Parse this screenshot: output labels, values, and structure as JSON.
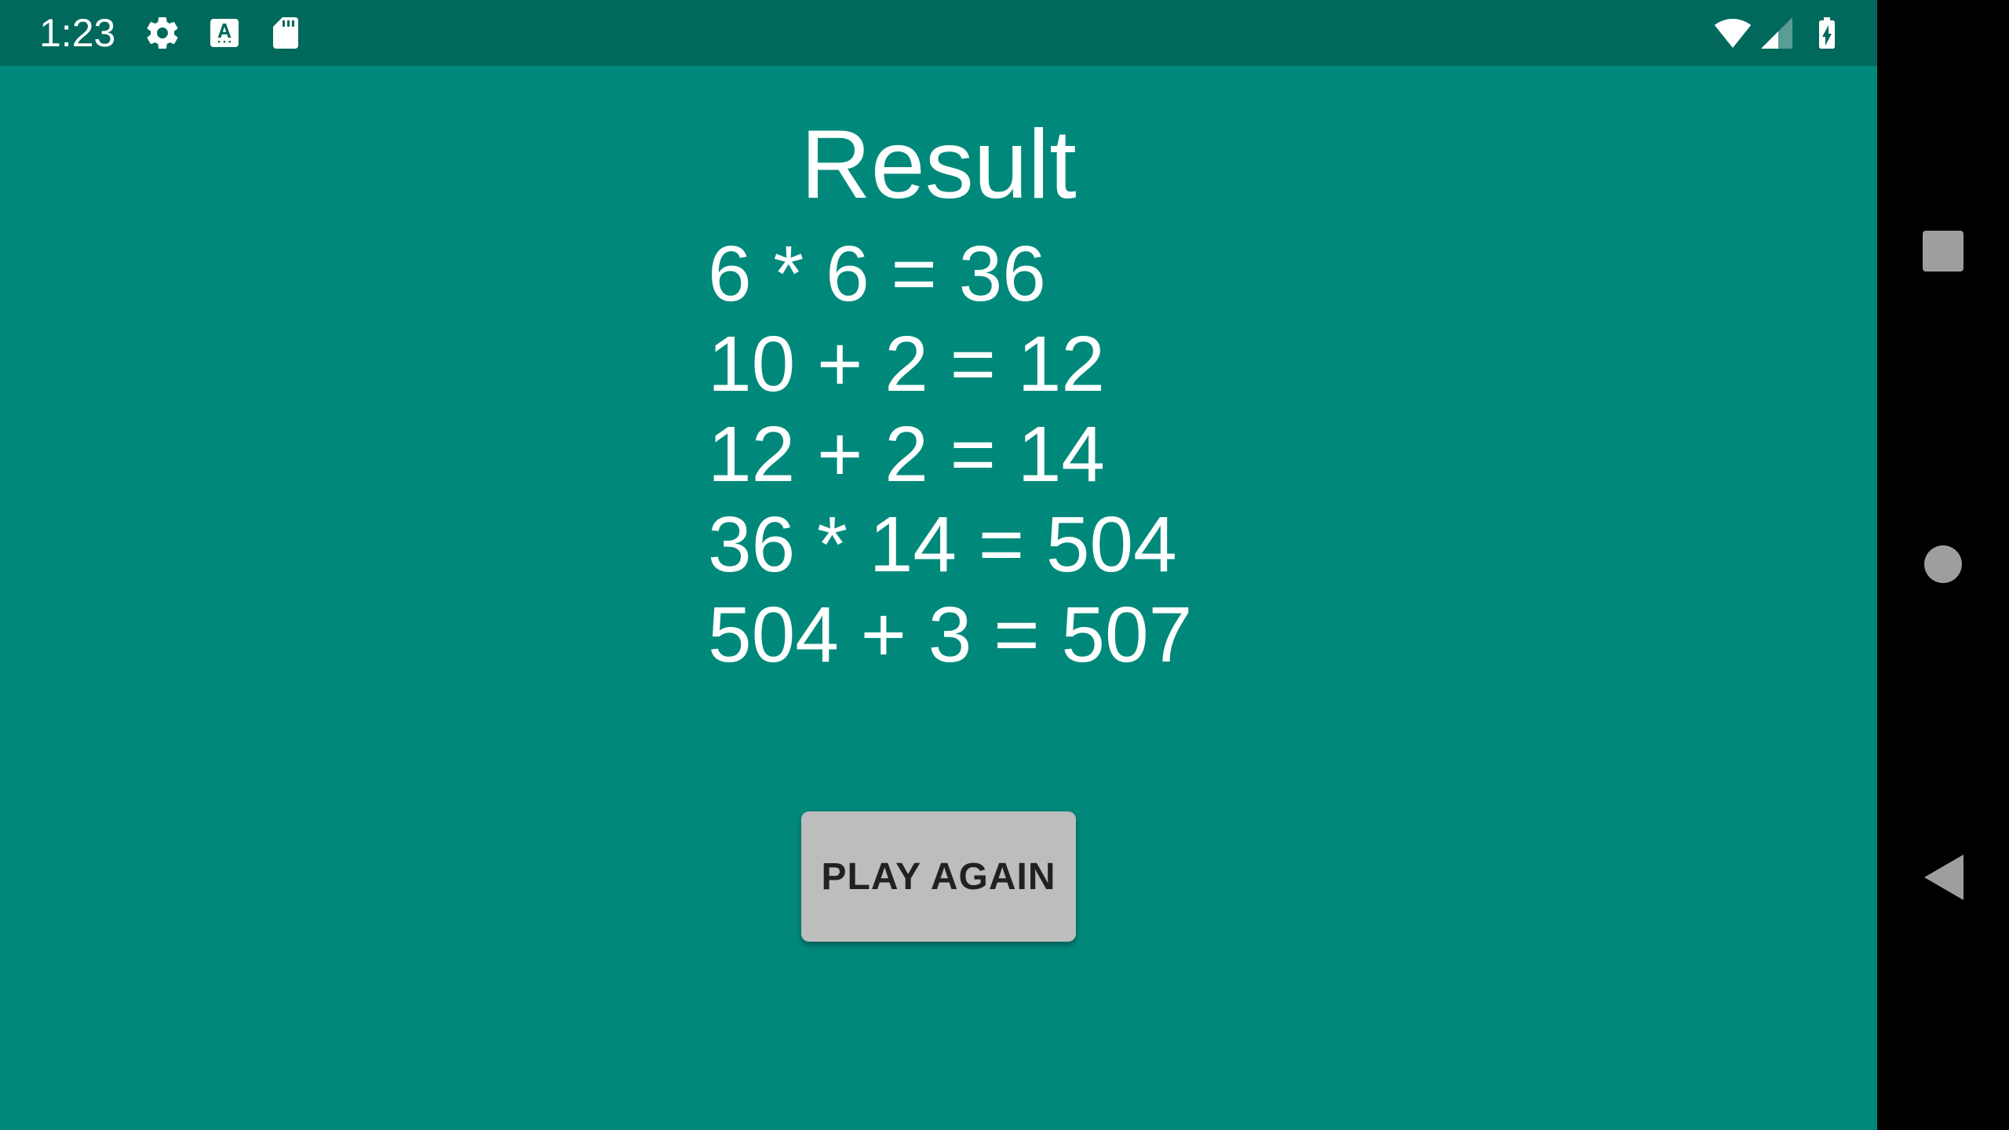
{
  "status_bar": {
    "time": "1:23",
    "icons": [
      "gear-icon",
      "keyboard-a-icon",
      "sd-card-icon",
      "wifi-icon",
      "cell-signal-icon",
      "battery-charging-icon"
    ],
    "background": "#00695C"
  },
  "main": {
    "title": "Result",
    "results": [
      "6 * 6 = 36",
      "10 + 2 = 12",
      "12 + 2 = 14",
      "36 * 14 = 504",
      "504 + 3 = 507"
    ],
    "play_again_label": "PLAY AGAIN",
    "background": "#00897B",
    "button_color": "#BDBDBD"
  },
  "nav_bar": {
    "buttons": [
      "recents-square-icon",
      "home-circle-icon",
      "back-triangle-icon"
    ]
  }
}
